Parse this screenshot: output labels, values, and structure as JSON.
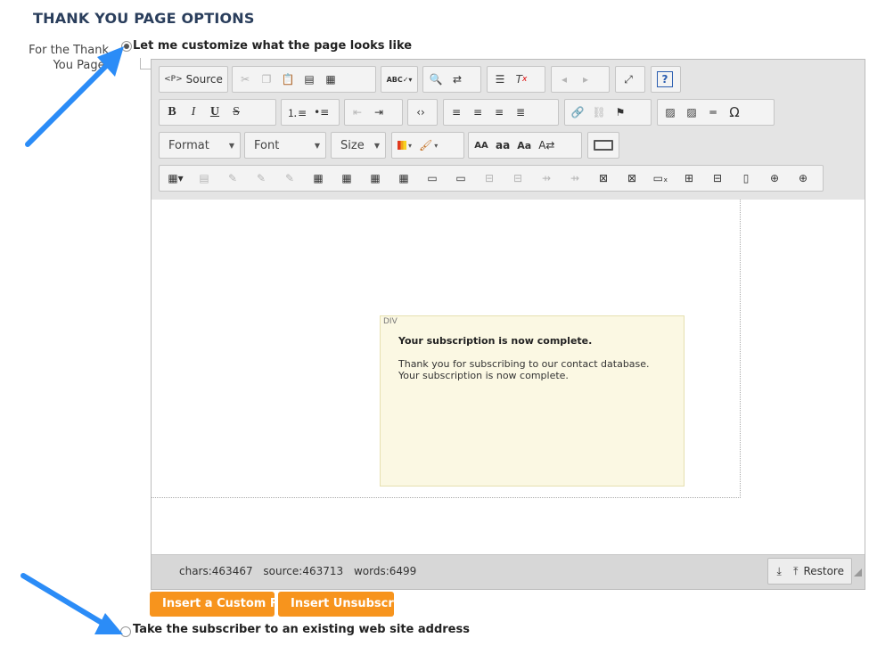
{
  "section_title": "THANK YOU PAGE OPTIONS",
  "row_label": "For the Thank You Page:",
  "options": {
    "customize": "Let me customize what the page looks like",
    "redirect": "Take the subscriber to an existing web site address"
  },
  "toolbar": {
    "source": "Source",
    "format": "Format",
    "font": "Font",
    "size": "Size",
    "bold": "B",
    "italic": "I",
    "underline": "U",
    "strike": "S",
    "omega": "Ω",
    "help": "?",
    "tx": "T",
    "case_upper": "AA",
    "case_lower": "aa",
    "case_title": "Aa"
  },
  "content": {
    "div_tag": "DIV",
    "title": "Your subscription is now complete.",
    "body": "Thank you for subscribing to our contact database. Your subscription is now complete."
  },
  "status": {
    "chars": "chars:463467",
    "source": "source:463713",
    "words": "words:6499",
    "restore": "Restore"
  },
  "buttons": {
    "insert_custom_field": "Insert a Custom Field",
    "insert_unsubscribe": "Insert Unsubscribe"
  },
  "colors": {
    "accent_orange": "#f7941d",
    "title_navy": "#2a3e5c",
    "arrow_blue": "#2b8cf7",
    "div_bg": "#fbf8e3"
  }
}
